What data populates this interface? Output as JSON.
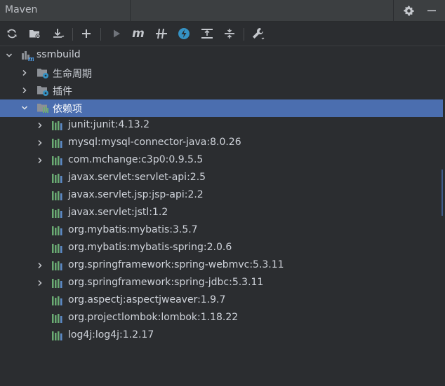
{
  "window": {
    "title": "Maven"
  },
  "titlebar": {
    "settings_icon": "gear-icon",
    "minimize_icon": "minimize-icon"
  },
  "toolbar": {
    "buttons": [
      {
        "name": "reload-button",
        "icon": "reload-icon"
      },
      {
        "name": "add-project-button",
        "icon": "folder-add-icon"
      },
      {
        "name": "download-button",
        "icon": "download-icon"
      },
      {
        "name": "add-button",
        "icon": "plus-icon"
      },
      {
        "name": "run-button",
        "icon": "play-icon"
      },
      {
        "name": "execute-goal-button",
        "icon": "maven-m-icon"
      },
      {
        "name": "toggle-offline-button",
        "icon": "offline-icon"
      },
      {
        "name": "skip-tests-button",
        "icon": "lightning-icon"
      },
      {
        "name": "show-dependencies-button",
        "icon": "dependencies-icon"
      },
      {
        "name": "collapse-all-button",
        "icon": "collapse-icon"
      },
      {
        "name": "settings-button",
        "icon": "wrench-icon"
      }
    ]
  },
  "tree": {
    "root": {
      "label": "ssmbuild",
      "icon": "maven-module-icon"
    },
    "lifecycle": {
      "label": "生命周期",
      "icon": "folder-gear-icon"
    },
    "plugins": {
      "label": "插件",
      "icon": "folder-gear-icon"
    },
    "dependencies": {
      "label": "依赖项",
      "icon": "folder-library-icon"
    },
    "deps": [
      {
        "label": "junit:junit:4.13.2",
        "expandable": true
      },
      {
        "label": "mysql:mysql-connector-java:8.0.26",
        "expandable": true
      },
      {
        "label": "com.mchange:c3p0:0.9.5.5",
        "expandable": true
      },
      {
        "label": "javax.servlet:servlet-api:2.5",
        "expandable": false
      },
      {
        "label": "javax.servlet.jsp:jsp-api:2.2",
        "expandable": false
      },
      {
        "label": "javax.servlet:jstl:1.2",
        "expandable": false
      },
      {
        "label": "org.mybatis:mybatis:3.5.7",
        "expandable": false
      },
      {
        "label": "org.mybatis:mybatis-spring:2.0.6",
        "expandable": false
      },
      {
        "label": "org.springframework:spring-webmvc:5.3.11",
        "expandable": true
      },
      {
        "label": "org.springframework:spring-jdbc:5.3.11",
        "expandable": true
      },
      {
        "label": "org.aspectj:aspectjweaver:1.9.7",
        "expandable": false
      },
      {
        "label": "org.projectlombok:lombok:1.18.22",
        "expandable": false
      },
      {
        "label": "log4j:log4j:1.2.17",
        "expandable": false
      }
    ]
  },
  "colors": {
    "background": "#2b2d30",
    "selection": "#4b6eaf",
    "library_green": "#6aab73",
    "library_blue": "#5e8dc9"
  }
}
